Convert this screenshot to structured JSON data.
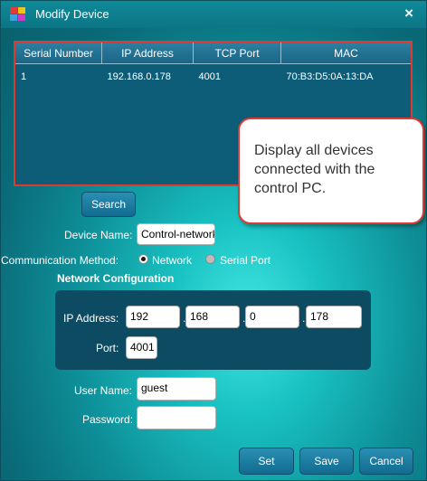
{
  "window": {
    "title": "Modify Device",
    "close_glyph": "×",
    "logo_colors": [
      "#e23b3b",
      "#f0c419",
      "#3aa0e0",
      "#c93cc9"
    ]
  },
  "device_table": {
    "columns": [
      "Serial Number",
      "IP Address",
      "TCP Port",
      "MAC"
    ],
    "rows": [
      [
        "1",
        "192.168.0.178",
        "4001",
        "70:B3:D5:0A:13:DA"
      ]
    ]
  },
  "callout": {
    "text": "Display all devices connected with the control PC.",
    "border_color": "#e0392f"
  },
  "search_button": "Search",
  "device_name": {
    "label": "Device Name:",
    "value": "Control-network"
  },
  "communication": {
    "label": "Communication Method:",
    "options": [
      {
        "label": "Network",
        "selected": true
      },
      {
        "label": "Serial Port",
        "selected": false
      }
    ]
  },
  "network_config": {
    "title": "Network Configuration",
    "ip_label": "IP Address:",
    "ip_octets": [
      "192",
      "168",
      "0",
      "178"
    ],
    "ip_separator": ".",
    "port_label": "Port:",
    "port_value": "4001"
  },
  "credentials": {
    "user_label": "User Name:",
    "user_value": "guest",
    "password_label": "Password:",
    "password_value": ""
  },
  "buttons": {
    "set": "Set",
    "save": "Save",
    "cancel": "Cancel"
  },
  "icons": {
    "logo": "app-logo-icon",
    "close": "close-icon",
    "radio_on": "radio-selected-icon",
    "radio_off": "radio-unselected-icon"
  }
}
